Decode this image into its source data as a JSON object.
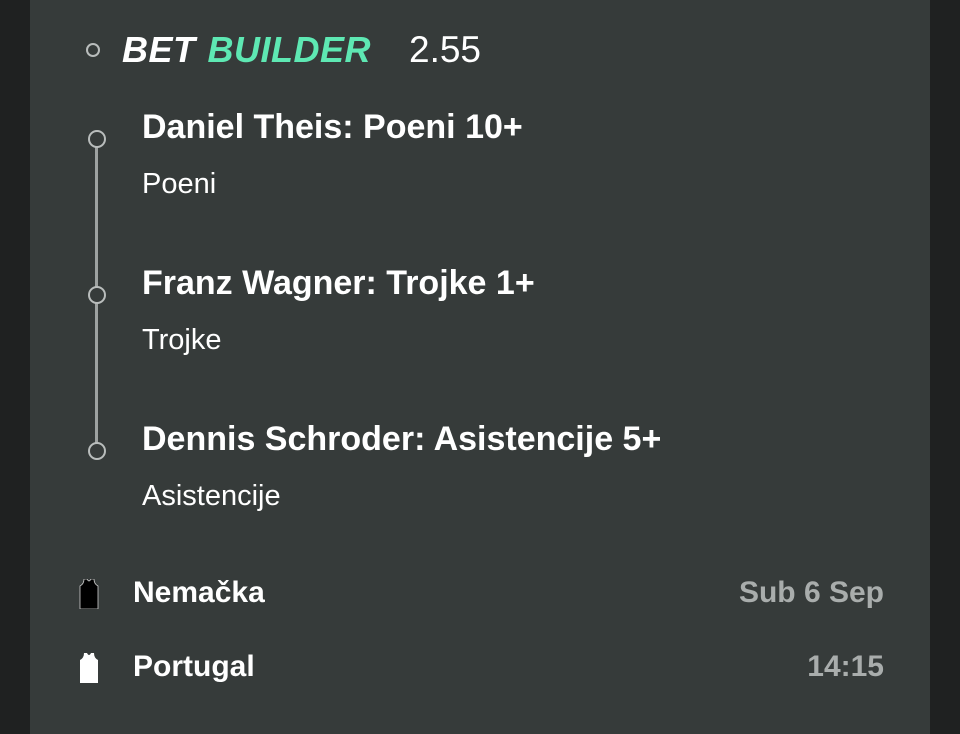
{
  "header": {
    "bet": "BET",
    "builder": "BUILDER",
    "odds": "2.55"
  },
  "legs": [
    {
      "title": "Daniel Theis: Poeni 10+",
      "market": "Poeni"
    },
    {
      "title": "Franz Wagner: Trojke 1+",
      "market": "Trojke"
    },
    {
      "title": "Dennis Schroder: Asistencije 5+",
      "market": "Asistencije"
    }
  ],
  "teams": [
    {
      "name": "Nemačka",
      "meta": "Sub 6 Sep",
      "jersey_color": "#000000",
      "icon": "jersey-icon"
    },
    {
      "name": "Portugal",
      "meta": "14:15",
      "jersey_color": "#ffffff",
      "icon": "jersey-icon"
    }
  ],
  "colors": {
    "accent": "#5ee8b3",
    "card_bg": "#363b3a",
    "muted_text": "#a9adac"
  }
}
